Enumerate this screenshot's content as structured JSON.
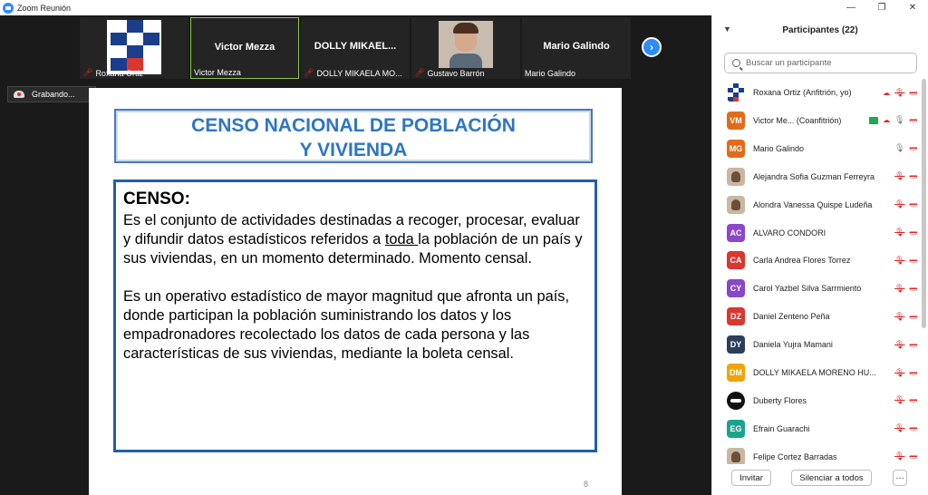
{
  "window": {
    "title": "Zoom Reunión",
    "controls": {
      "minimize": "—",
      "restore": "❐",
      "close": "✕"
    }
  },
  "thumbnails": [
    {
      "name": "Roxana Ortiz",
      "display": "logo",
      "muted": true
    },
    {
      "name": "Victor Mezza",
      "big_name": "Victor Mezza",
      "display": "name",
      "muted": false,
      "active": true
    },
    {
      "name": "DOLLY MIKAELA MO...",
      "big_name": "DOLLY MIKAEL...",
      "display": "name",
      "muted": true
    },
    {
      "name": "Gustavo Barrón",
      "display": "photo",
      "muted": true
    },
    {
      "name": "Mario Galindo",
      "big_name": "Mario Galindo",
      "display": "name",
      "muted": false
    }
  ],
  "next_page_icon": "chevron-right-icon",
  "recording": {
    "label": "Grabando..."
  },
  "slide": {
    "title_line1": "CENSO NACIONAL DE POBLACIÓN",
    "title_line2": "Y VIVIENDA",
    "heading": "CENSO:",
    "para1_before": "Es el conjunto de actividades destinadas a recoger, procesar, evaluar y difundir datos estadísticos referidos a ",
    "para1_underlined": "toda ",
    "para1_after": "la población de un país y sus viviendas, en un momento determinado. Momento censal.",
    "para2": "Es un operativo estadístico de mayor magnitud que afronta un país, donde participan la población suministrando los datos y los empadronadores recolectado los datos de cada persona y las características de sus viviendas, mediante la boleta censal.",
    "page_number": "8"
  },
  "panel": {
    "title": "Participantes (22)",
    "search_placeholder": "Buscar un participante",
    "invite_label": "Invitar",
    "mute_all_label": "Silenciar a todos",
    "more_label": "···",
    "participants": [
      {
        "initials": "",
        "avatar": "logo",
        "color": "#ffffff",
        "name": "Roxana Ortiz (Anfitrión, yo)",
        "recording": true,
        "mic": "muted",
        "video": "muted"
      },
      {
        "initials": "VM",
        "avatar": "initials",
        "color": "#e06c1a",
        "name": "Victor Me... (Coanfitrión)",
        "sharing": true,
        "recording": true,
        "mic": "on",
        "video": "muted"
      },
      {
        "initials": "MG",
        "avatar": "initials",
        "color": "#e06c1a",
        "name": "Mario Galindo",
        "mic": "on",
        "video": "muted"
      },
      {
        "initials": "",
        "avatar": "photo",
        "color": "#c9b7a4",
        "name": "Alejandra Sofia Guzman Ferreyra",
        "mic": "muted",
        "video": "muted"
      },
      {
        "initials": "",
        "avatar": "photo",
        "color": "#c9b7a4",
        "name": "Alondra Vanessa Quispe Ludeña",
        "mic": "muted",
        "video": "muted"
      },
      {
        "initials": "AC",
        "avatar": "initials",
        "color": "#8c47c9",
        "name": "ALVARO CONDORI",
        "mic": "muted",
        "video": "muted"
      },
      {
        "initials": "CA",
        "avatar": "initials",
        "color": "#d9372f",
        "name": "Carla Andrea Flores Torrez",
        "mic": "muted",
        "video": "muted"
      },
      {
        "initials": "CY",
        "avatar": "initials",
        "color": "#8c47c9",
        "name": "Carol Yazbel Silva Sarrmiento",
        "mic": "muted",
        "video": "muted"
      },
      {
        "initials": "DZ",
        "avatar": "initials",
        "color": "#d9372f",
        "name": "Daniel Zenteno Peña",
        "mic": "muted",
        "video": "muted"
      },
      {
        "initials": "DY",
        "avatar": "initials",
        "color": "#2b3e5c",
        "name": "Daniela Yujra Mamani",
        "mic": "muted",
        "video": "muted"
      },
      {
        "initials": "DM",
        "avatar": "initials",
        "color": "#f0a30a",
        "name": "DOLLY MIKAELA MORENO HU...",
        "mic": "muted",
        "video": "muted"
      },
      {
        "initials": "",
        "avatar": "circle",
        "color": "#111111",
        "name": "Duberty Flores",
        "mic": "muted",
        "video": "muted"
      },
      {
        "initials": "EG",
        "avatar": "initials",
        "color": "#1aa38c",
        "name": "Efrain Guarachi",
        "mic": "muted",
        "video": "muted"
      },
      {
        "initials": "",
        "avatar": "photo",
        "color": "#c9b7a4",
        "name": "Felipe Cortez Barradas",
        "mic": "muted",
        "video": "muted"
      }
    ]
  }
}
